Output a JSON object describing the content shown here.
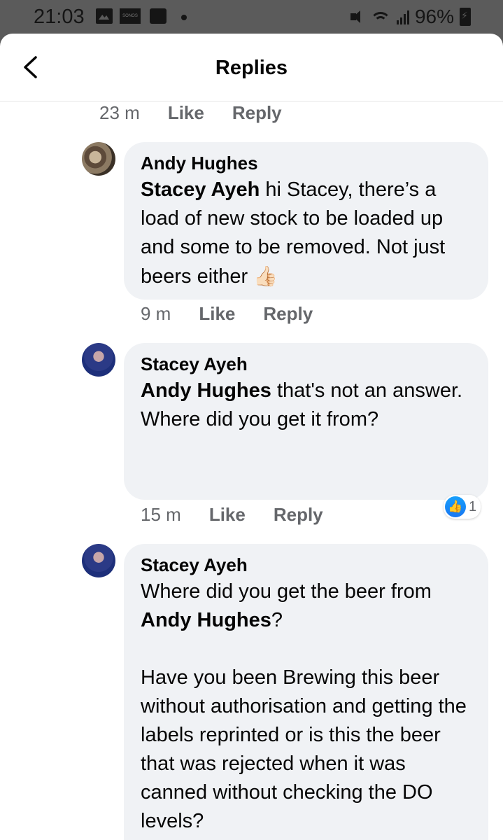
{
  "status_bar": {
    "time": "21:03",
    "battery": "96%",
    "sonos_label": "SONOS"
  },
  "header": {
    "title": "Replies"
  },
  "comments": [
    {
      "meta": {
        "age": "23 m",
        "like": "Like",
        "reply": "Reply"
      }
    },
    {
      "author": "Andy Hughes",
      "mention": "Stacey Ayeh",
      "text": " hi Stacey, there’s a load of new stock to be loaded up and some to be removed. Not just beers either ",
      "emoji": "👍🏻",
      "meta": {
        "age": "9 m",
        "like": "Like",
        "reply": "Reply"
      }
    },
    {
      "author": "Stacey Ayeh",
      "mention": "Andy Hughes",
      "text": " that's not an answer. Where did you get it from?",
      "reaction_count": "1",
      "meta": {
        "age": "15 m",
        "like": "Like",
        "reply": "Reply"
      }
    },
    {
      "author": "Stacey Ayeh",
      "text_before": "Where did you get the beer from ",
      "mention": "Andy Hughes",
      "text_after": "?",
      "paragraph2": "Have you been Brewing this beer without authorisation and getting the labels reprinted or is this the beer that was rejected when it was canned without checking the DO levels?"
    }
  ]
}
